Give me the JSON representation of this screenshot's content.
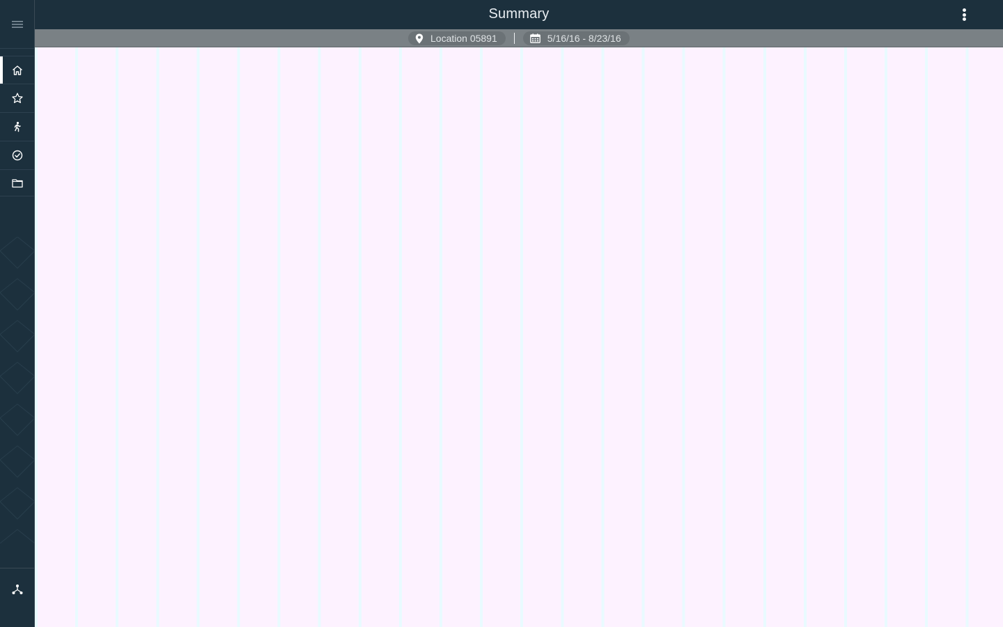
{
  "header": {
    "title": "Summary"
  },
  "filters": {
    "location": "Location 05891",
    "date_range": "5/16/16 - 8/23/16"
  },
  "sidebar": {
    "menu_icon": "hamburger-icon",
    "items": [
      {
        "icon": "home-icon",
        "active": true
      },
      {
        "icon": "star-icon",
        "active": false
      },
      {
        "icon": "runner-icon",
        "active": false
      },
      {
        "icon": "check-circle-icon",
        "active": false
      },
      {
        "icon": "folder-icon",
        "active": false
      }
    ],
    "bottom_icon": "network-icon"
  },
  "colors": {
    "sidebar_bg": "#1c303d",
    "filter_bar_bg": "#7a8185",
    "content_bg": "#fdf2ff",
    "column_stripe": "#e9fbff"
  }
}
